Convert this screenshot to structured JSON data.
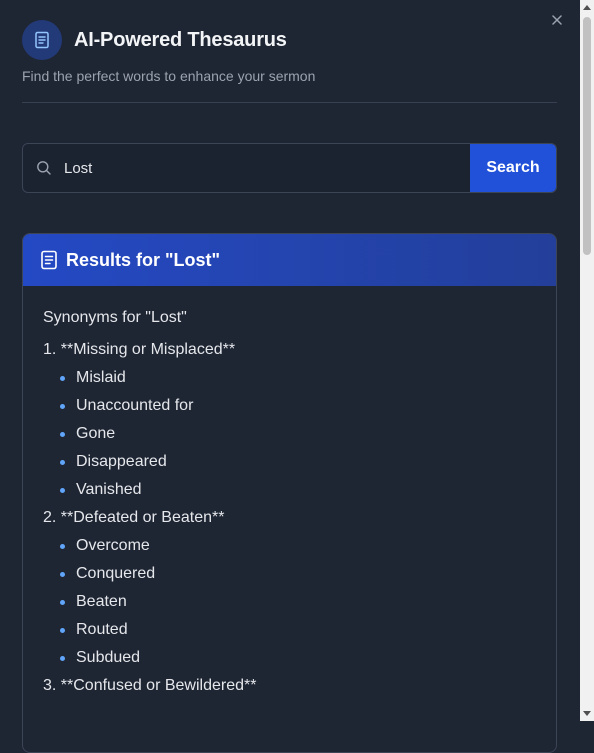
{
  "header": {
    "title": "AI-Powered Thesaurus",
    "subtitle": "Find the perfect words to enhance your sermon",
    "logo_icon": "book-icon",
    "close_icon": "close-icon"
  },
  "search": {
    "value": "Lost",
    "placeholder": "",
    "button_label": "Search",
    "icon": "search-icon"
  },
  "results": {
    "title": "Results for \"Lost\"",
    "icon": "document-icon",
    "intro": "Synonyms for \"Lost\"",
    "groups": [
      {
        "title": "1. **Missing or Misplaced**",
        "items": [
          "Mislaid",
          "Unaccounted for",
          "Gone",
          "Disappeared",
          "Vanished"
        ]
      },
      {
        "title": "2. **Defeated or Beaten**",
        "items": [
          "Overcome",
          "Conquered",
          "Beaten",
          "Routed",
          "Subdued"
        ]
      },
      {
        "title": "3. **Confused or Bewildered**",
        "items": []
      }
    ]
  },
  "colors": {
    "background": "#1e2533",
    "accent": "#2150d9",
    "bullet": "#60a5fa"
  }
}
